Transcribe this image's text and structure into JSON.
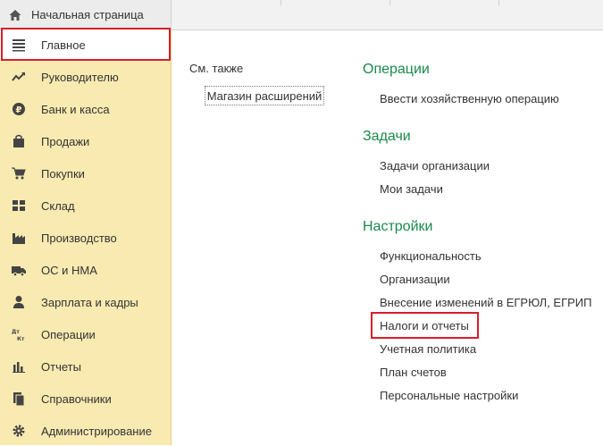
{
  "top_tab": {
    "label": "Начальная страница",
    "icon": "home-icon"
  },
  "sidebar": {
    "items": [
      {
        "label": "Главное",
        "icon": "menu-icon",
        "active": true
      },
      {
        "label": "Руководителю",
        "icon": "trend-icon"
      },
      {
        "label": "Банк и касса",
        "icon": "ruble-coin-icon"
      },
      {
        "label": "Продажи",
        "icon": "bag-icon"
      },
      {
        "label": "Покупки",
        "icon": "cart-icon"
      },
      {
        "label": "Склад",
        "icon": "grid-icon"
      },
      {
        "label": "Производство",
        "icon": "factory-icon"
      },
      {
        "label": "ОС и НМА",
        "icon": "truck-icon"
      },
      {
        "label": "Зарплата и кадры",
        "icon": "person-icon"
      },
      {
        "label": "Операции",
        "icon": "dt-kt-icon"
      },
      {
        "label": "Отчеты",
        "icon": "bar-chart-icon"
      },
      {
        "label": "Справочники",
        "icon": "book-icon"
      },
      {
        "label": "Администрирование",
        "icon": "gear-icon"
      }
    ]
  },
  "see_also": {
    "label": "См. также",
    "link": "Магазин расширений"
  },
  "sections": {
    "operations": {
      "title": "Операции",
      "links": [
        "Ввести хозяйственную операцию"
      ]
    },
    "tasks": {
      "title": "Задачи",
      "links": [
        "Задачи организации",
        "Мои задачи"
      ]
    },
    "settings": {
      "title": "Настройки",
      "links": [
        "Функциональность",
        "Организации",
        "Внесение изменений в ЕГРЮЛ, ЕГРИП",
        "Налоги и отчеты",
        "Учетная политика",
        "План счетов",
        "Персональные настройки"
      ]
    }
  },
  "colors": {
    "sidebar_bg": "#f9eab1",
    "section_title": "#1a8a4b",
    "highlight": "#d81e2b"
  }
}
